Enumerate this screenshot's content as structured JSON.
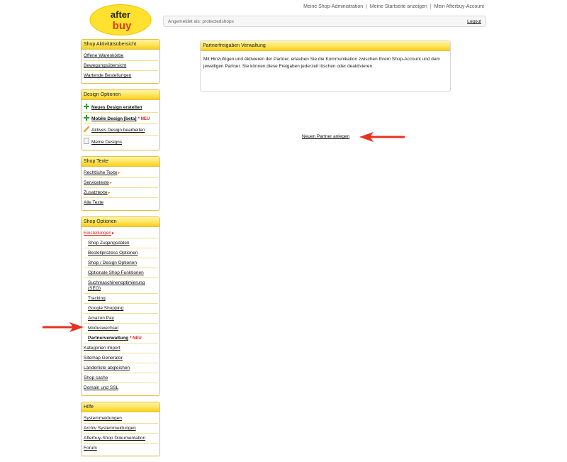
{
  "logo": {
    "text_top": "after",
    "text_bottom": "buy"
  },
  "top_links": [
    "Meine Shop-Administration",
    "Meine Startseite anzeigen",
    "Mein Afterbuy-Account"
  ],
  "top_links_separator": "|",
  "login": {
    "label": "Angemeldet als: protectedshops",
    "logout": "Logout"
  },
  "sidebar": {
    "aktivitaet": {
      "title": "Shop Aktivitätsübersicht",
      "items": [
        "Offene Warenkörbe",
        "Bewegungsübersicht",
        "Wartende Bestellungen"
      ]
    },
    "design": {
      "title": "Design Optionen",
      "items": [
        "Neues Design erstellen",
        "Mobile Design [beta]",
        "Aktives Design bearbeiten",
        "Meine Designs"
      ],
      "neu": "* NEU"
    },
    "texte": {
      "title": "Shop Texte",
      "items": [
        "Rechtliche Texte",
        "Servicetexte",
        "Zusatztexte",
        "Alle Texte"
      ]
    },
    "optionen": {
      "title": "Shop Optionen",
      "einstellungen": "Einstellungen",
      "sub_items": [
        "Shop Zugangsdaten",
        "Bestellprozess Optionen",
        "Shop / Design Optionen",
        "Optionale Shop Funktionen",
        "Suchmaschinenoptimierung (SEO)",
        "Tracking",
        "Google Shopping",
        "Amazon Pay",
        "Moduswechsel"
      ],
      "partner": "Partnerverwaltung",
      "neu": "* NEU",
      "items": [
        "Kategorien Import",
        "Sitemap Generator",
        "Länderliste abgleichen",
        "Shop cache",
        "Domain und SSL"
      ]
    },
    "hilfe": {
      "title": "Hilfe",
      "items": [
        "Systemmeldungen",
        "Archiv Systemmeldungen",
        "Afterbuy-Shop Dokumentation",
        "Forum"
      ]
    }
  },
  "panel": {
    "title": "Partnerfreigaben Verwaltung",
    "text": "Mit Hinzufügen und Aktivieren der Partner, erlauben Sie die Kommunikation zwischen Ihrem Shop-Account und dem jeweiligen Partner. Sie können diese Freigaben jederzeit löschen oder deaktivieren."
  },
  "new_partner_link": "Neuen Partner anlegen",
  "colors": {
    "accent_yellow": "#ffe45c",
    "red": "#d8201b",
    "arrow_red": "#e8311f"
  }
}
